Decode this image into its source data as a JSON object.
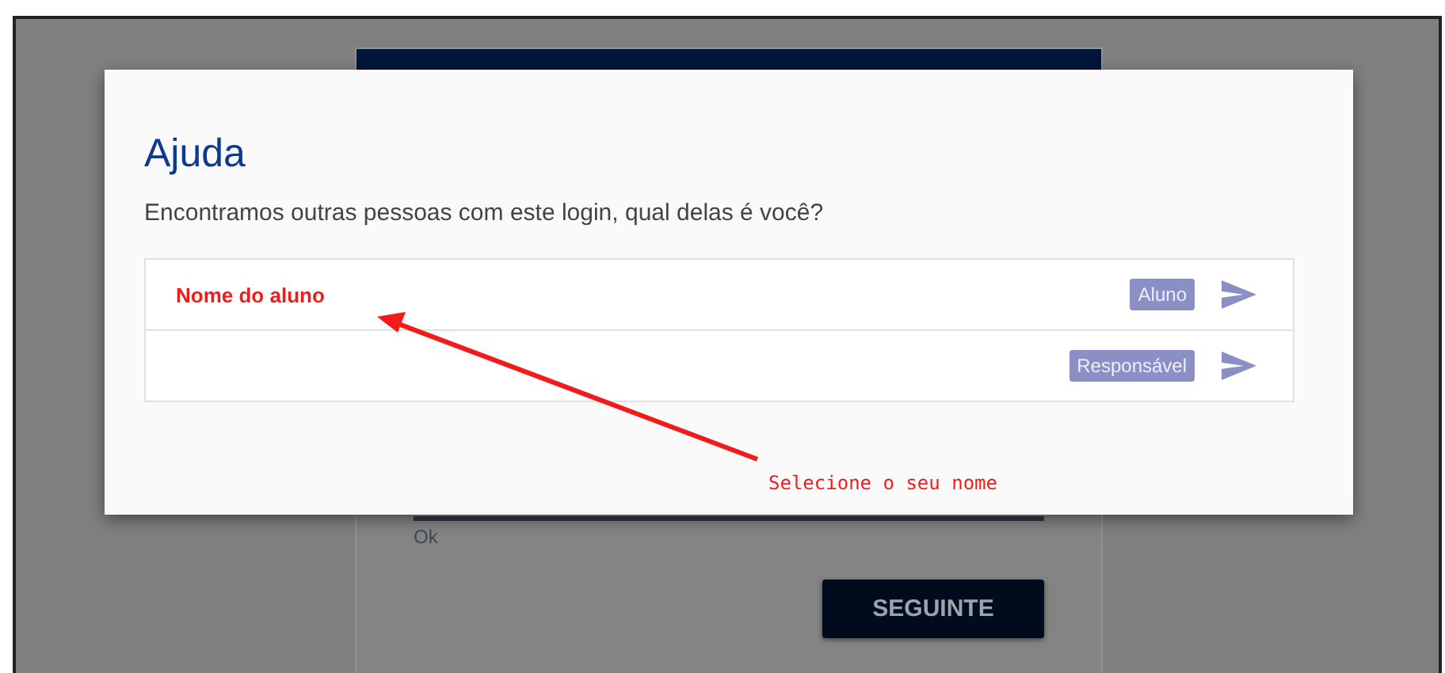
{
  "dialog": {
    "title": "Ajuda",
    "message": "Encontramos outras pessoas com este login, qual delas é você?",
    "options": [
      {
        "name": "Nome do aluno",
        "role": "Aluno"
      },
      {
        "role": "Responsável"
      }
    ]
  },
  "background_form": {
    "helper_text": "Ok",
    "button": "SEGUINTE"
  },
  "annotation": {
    "text": "Selecione o seu nome"
  }
}
